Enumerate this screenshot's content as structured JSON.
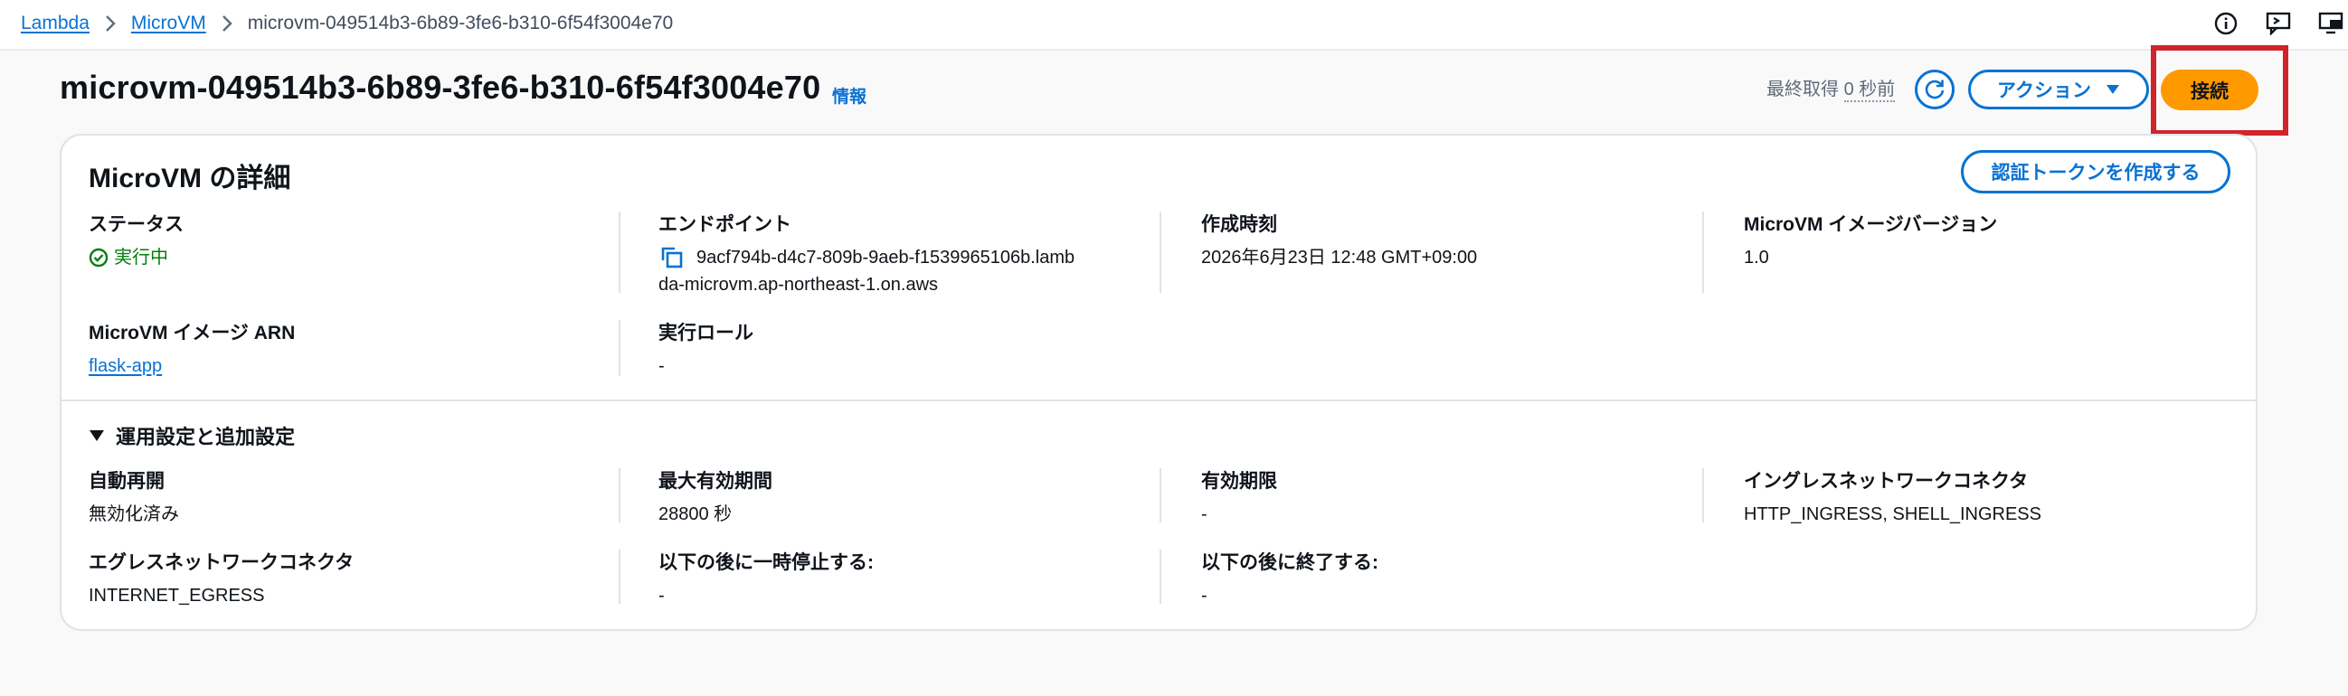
{
  "breadcrumb": {
    "items": [
      "Lambda",
      "MicroVM"
    ],
    "current": "microvm-049514b3-6b89-3fe6-b310-6f54f3004e70"
  },
  "top_icons": [
    "info-circle-icon",
    "feedback-icon",
    "screen-icon"
  ],
  "header": {
    "title": "microvm-049514b3-6b89-3fe6-b310-6f54f3004e70",
    "info_link": "情報",
    "last_fetched_label": "最終取得",
    "last_fetched_value": "0 秒前",
    "actions_label": "アクション",
    "connect_label": "接続"
  },
  "details": {
    "title": "MicroVM の詳細",
    "create_token_label": "認証トークンを作成する",
    "status_label": "ステータス",
    "status_value": "実行中",
    "endpoint_label": "エンドポイント",
    "endpoint_line1": "9acf794b-d4c7-809b-9aeb-f1539965106b.lamb",
    "endpoint_line2": "da-microvm.ap-northeast-1.on.aws",
    "created_label": "作成時刻",
    "created_value": "2026年6月23日 12:48 GMT+09:00",
    "image_version_label": "MicroVM イメージバージョン",
    "image_version_value": "1.0",
    "image_arn_label": "MicroVM イメージ ARN",
    "image_arn_value": "flask-app",
    "exec_role_label": "実行ロール",
    "exec_role_value": "-"
  },
  "advanced": {
    "title": "運用設定と追加設定",
    "auto_restart_label": "自動再開",
    "auto_restart_value": "無効化済み",
    "max_lifetime_label": "最大有効期間",
    "max_lifetime_value": "28800 秒",
    "expiry_label": "有効期限",
    "expiry_value": "-",
    "ingress_label": "イングレスネットワークコネクタ",
    "ingress_value": "HTTP_INGRESS, SHELL_INGRESS",
    "egress_label": "エグレスネットワークコネクタ",
    "egress_value": "INTERNET_EGRESS",
    "pause_after_label": "以下の後に一時停止する:",
    "pause_after_value": "-",
    "terminate_after_label": "以下の後に終了する:",
    "terminate_after_value": "-"
  },
  "colors": {
    "link": "#0972d3",
    "primary_button": "#ff9900",
    "highlight": "#d0242b",
    "success": "#037f0c"
  }
}
